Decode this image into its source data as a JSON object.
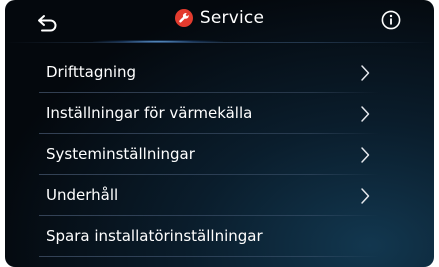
{
  "header": {
    "title": "Service",
    "back_icon": "back-arrow-icon",
    "title_icon": "wrench-icon",
    "info_icon": "info-icon",
    "accent_color": "#e33b2e"
  },
  "menu": {
    "items": [
      {
        "label": "Drifttagning",
        "has_chevron": true
      },
      {
        "label": "Inställningar för värmekälla",
        "has_chevron": true
      },
      {
        "label": "Systeminställningar",
        "has_chevron": true
      },
      {
        "label": "Underhåll",
        "has_chevron": true
      },
      {
        "label": "Spara installatörinställningar",
        "has_chevron": false
      }
    ]
  }
}
